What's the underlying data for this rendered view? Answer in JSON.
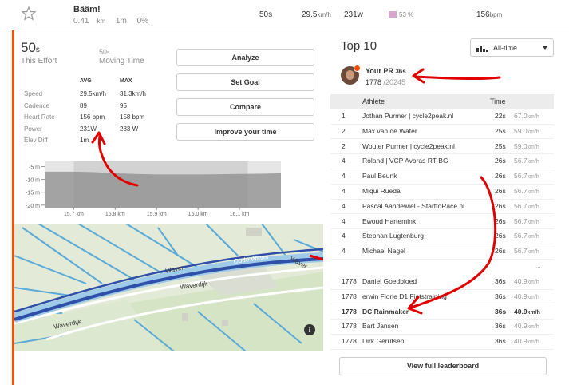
{
  "segment": {
    "name": "Bääm!",
    "distance": "0.41",
    "distance_unit": "km",
    "elev": "1m",
    "grade": "0%"
  },
  "top_row": {
    "time": "50s",
    "speed": "29.5",
    "speed_unit": "km/h",
    "power": "231w",
    "hr_pct": "53 %",
    "hr": "156",
    "hr_unit": "bpm",
    "hr_color": "#d8a7cf"
  },
  "effort": {
    "this_effort_value": "50",
    "this_effort_unit": "s",
    "this_effort_label": "This Effort",
    "moving_value": "50",
    "moving_unit": "s",
    "moving_label": "Moving Time"
  },
  "actions": {
    "analyze": "Analyze",
    "set_goal": "Set Goal",
    "compare": "Compare",
    "improve": "Improve your time"
  },
  "stats": {
    "avg_header": "AVG",
    "max_header": "MAX",
    "rows": [
      {
        "label": "Speed",
        "avg": "29.5km/h",
        "max": "31.3km/h"
      },
      {
        "label": "Cadence",
        "avg": "89",
        "max": "95"
      },
      {
        "label": "Heart Rate",
        "avg": "156 bpm",
        "max": "158 bpm"
      },
      {
        "label": "Power",
        "avg": "231W",
        "max": "283 W"
      },
      {
        "label": "Elev Diff",
        "avg": "1m",
        "max": ""
      }
    ]
  },
  "chart_data": {
    "type": "area",
    "y_ticks": [
      "-5 m",
      "-10 m",
      "-15 m",
      "-20 m"
    ],
    "x_ticks": [
      "15.7 km",
      "15.8 km",
      "15.9 km",
      "16.0 km",
      "16.1 km"
    ],
    "ylim": [
      -21,
      -3
    ],
    "series": [
      {
        "x": [
          15.63,
          15.7,
          15.75,
          15.8,
          15.85,
          15.9,
          15.95,
          16.0,
          16.05,
          16.1,
          16.15,
          16.2
        ],
        "values": [
          -7,
          -7,
          -7.2,
          -7.6,
          -7.9,
          -8.1,
          -8.1,
          -8.1,
          -8.0,
          -7.9,
          -7.8,
          -7.6
        ]
      }
    ]
  },
  "map": {
    "labels": [
      "Waver",
      "Oude Waver",
      "Waver",
      "Waverdijk",
      "Waverdijk"
    ],
    "info": "i"
  },
  "leaderboard": {
    "title": "Top 10",
    "filter": "All-time",
    "pr_title": "Your PR",
    "pr_time": "36s",
    "pr_rank": "1778",
    "pr_total": "/20245",
    "col_athlete": "Athlete",
    "col_time": "Time",
    "rows": [
      {
        "rank": "1",
        "name": "Jothan Purmer | cycle2peak.nl",
        "time": "22s",
        "speed": "67.0",
        "unit": "km/h"
      },
      {
        "rank": "2",
        "name": "Max van de Water",
        "time": "25s",
        "speed": "59.0",
        "unit": "km/h"
      },
      {
        "rank": "2",
        "name": "Wouter Purmer | cycle2peak.nl",
        "time": "25s",
        "speed": "59.0",
        "unit": "km/h"
      },
      {
        "rank": "4",
        "name": "Roland | VCP Avoras RT-BG",
        "time": "26s",
        "speed": "56.7",
        "unit": "km/h"
      },
      {
        "rank": "4",
        "name": "Paul Beunk",
        "time": "26s",
        "speed": "56.7",
        "unit": "km/h"
      },
      {
        "rank": "4",
        "name": "Miqui Rueda",
        "time": "26s",
        "speed": "56.7",
        "unit": "km/h"
      },
      {
        "rank": "4",
        "name": "Pascal Aandewiel - StarttoRace.nl",
        "time": "26s",
        "speed": "56.7",
        "unit": "km/h"
      },
      {
        "rank": "4",
        "name": "Ewoud Hartemink",
        "time": "26s",
        "speed": "56.7",
        "unit": "km/h"
      },
      {
        "rank": "4",
        "name": "Stephan Lugtenburg",
        "time": "26s",
        "speed": "56.7",
        "unit": "km/h"
      },
      {
        "rank": "4",
        "name": "Michael Nagel",
        "time": "26s",
        "speed": "56.7",
        "unit": "km/h"
      }
    ],
    "ellipsis": "...",
    "nearby": [
      {
        "rank": "1778",
        "name": "Daniel Goedbloed",
        "time": "36s",
        "speed": "40.9",
        "unit": "km/h"
      },
      {
        "rank": "1778",
        "name": "erwin Florie D1 Fietstraining",
        "time": "36s",
        "speed": "40.9",
        "unit": "km/h"
      },
      {
        "rank": "1778",
        "name": "DC Rainmaker",
        "time": "36s",
        "speed": "40.9",
        "unit": "km/h",
        "me": true
      },
      {
        "rank": "1778",
        "name": "Bart Jansen",
        "time": "36s",
        "speed": "40.9",
        "unit": "km/h"
      },
      {
        "rank": "1778",
        "name": "Dirk Gerritsen",
        "time": "36s",
        "speed": "40.9",
        "unit": "km/h"
      }
    ],
    "view_full": "View full leaderboard"
  },
  "colors": {
    "accent": "#fc4c02",
    "annotation": "#e00000",
    "route": "#2f4fa8"
  }
}
